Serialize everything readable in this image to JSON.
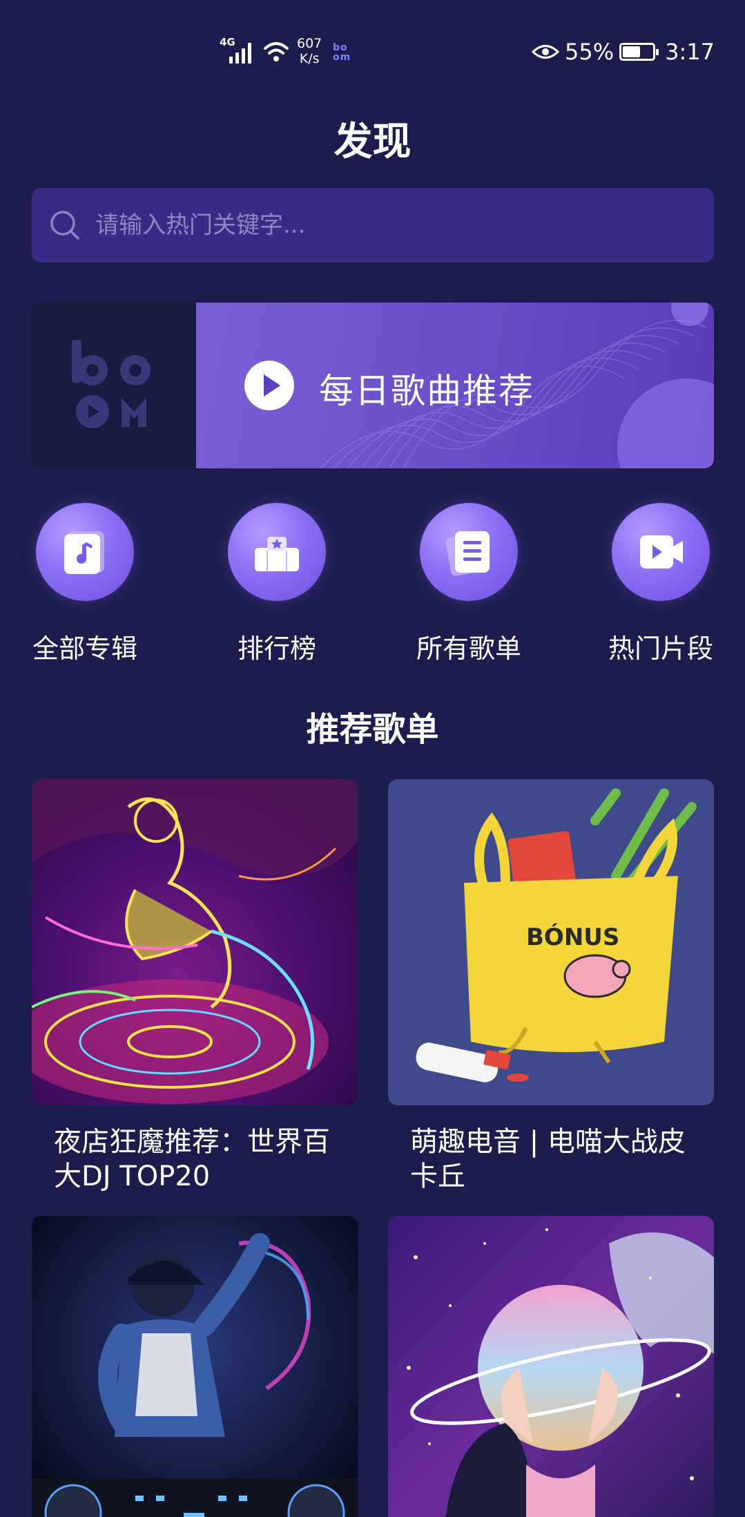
{
  "status_bar": {
    "network_type": "4G",
    "speed_value": "607",
    "speed_unit": "K/s",
    "app_badge": "bo om",
    "battery_text": "55%",
    "battery_level": 0.55,
    "time": "3:17"
  },
  "header": {
    "title": "发现"
  },
  "search": {
    "placeholder": "请输入热门关键字...",
    "value": ""
  },
  "banner": {
    "logo_text": "boom",
    "label": "每日歌曲推荐"
  },
  "quick_nav": [
    {
      "label": "全部专辑",
      "icon": "music-note-icon"
    },
    {
      "label": "排行榜",
      "icon": "podium-icon"
    },
    {
      "label": "所有歌单",
      "icon": "playlist-icon"
    },
    {
      "label": "热门片段",
      "icon": "video-icon"
    }
  ],
  "section": {
    "title": "推荐歌单"
  },
  "playlists": [
    {
      "title": "夜店狂魔推荐：世界百大DJ TOP20",
      "art": "neon-dj-artwork"
    },
    {
      "title": "萌趣电音 | 电喵大战皮卡丘",
      "art": "yellow-bag-bonus-artwork"
    },
    {
      "title": "",
      "art": "dj-performer-artwork"
    },
    {
      "title": "",
      "art": "galaxy-planet-artwork"
    }
  ],
  "colors": {
    "background": "#1c1d4d",
    "search_bg": "#3a2b86",
    "accent": "#7b5fd6"
  }
}
